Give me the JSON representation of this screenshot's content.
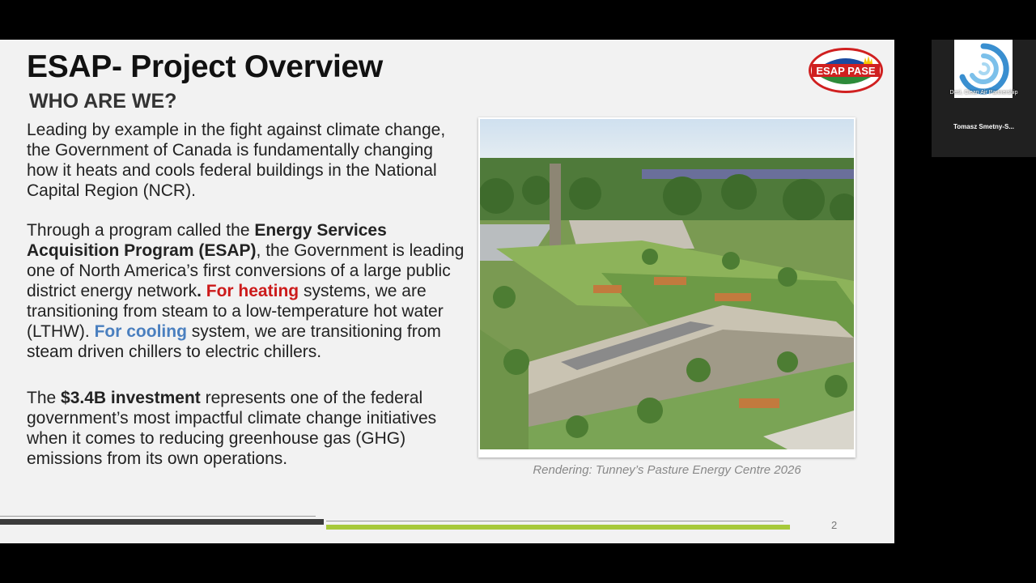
{
  "slide": {
    "title": "ESAP- Project Overview",
    "subtitle": "WHO ARE WE?",
    "logo_text": "ESAP PASE",
    "paragraphs": {
      "p1": "Leading by example in the fight against climate change, the Government of Canada is fundamentally changing how it heats and cools federal buildings in the National Capital Region (NCR).",
      "p2_a": "Through a program called the ",
      "p2_bold": "Energy Services Acquisition Program (ESAP)",
      "p2_b": ", the Government is leading one of North America’s first conversions of a large public district energy network",
      "p2_dot": ". ",
      "p2_red": "For heating",
      "p2_c": " systems, we are transitioning from steam to a low-temperature hot water (LTHW). ",
      "p2_blue": "For cooling",
      "p2_d": " system, we are transitioning from steam driven chillers to electric chillers.",
      "p3_a": "The ",
      "p3_bold": "$3.4B investment",
      "p3_b": " represents one of the federal government’s most impactful climate change initiatives when it comes to reducing greenhouse gas (GHG) emissions from its own operations."
    },
    "caption": "Rendering: Tunney’s Pasture Energy Centre 2026",
    "page_number": "2"
  },
  "participants": {
    "thumb_label": "Desi, Clean Air Partnership",
    "name": "Tomasz  Smetny-S..."
  },
  "colors": {
    "heating": "#cc1a1a",
    "cooling": "#4a7fbf",
    "accent_green": "#a7c93a",
    "logo_blue": "#1a4aa0",
    "logo_red": "#d02020"
  }
}
